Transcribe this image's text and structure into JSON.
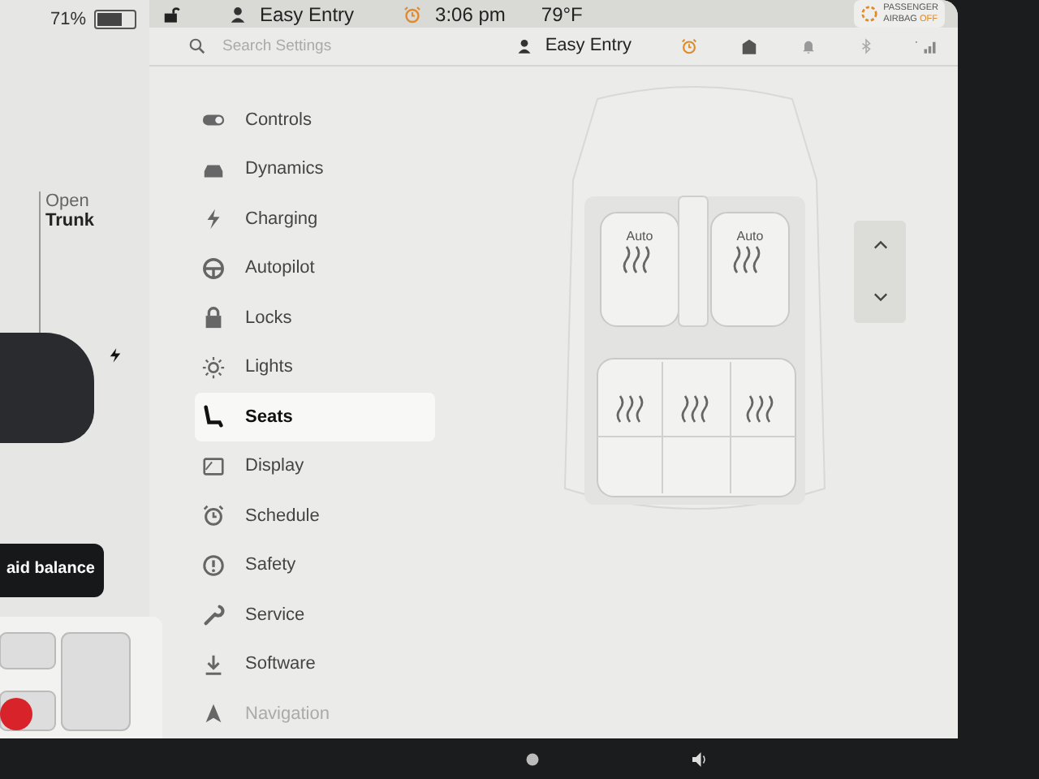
{
  "left_panel": {
    "battery_percent": "71%",
    "trunk": {
      "line1": "Open",
      "line2": "Trunk"
    },
    "banner": "aid balance"
  },
  "status_bar": {
    "profile": "Easy Entry",
    "time": "3:06 pm",
    "temperature": "79°F",
    "airbag": {
      "line1": "PASSENGER",
      "line2": "AIRBAG",
      "state": "OFF"
    }
  },
  "settings": {
    "search": {
      "placeholder": "Search Settings"
    },
    "profile": "Easy Entry",
    "menu": [
      {
        "label": "Controls",
        "kind": "toggle",
        "selected": false
      },
      {
        "label": "Dynamics",
        "kind": "car",
        "selected": false
      },
      {
        "label": "Charging",
        "kind": "bolt",
        "selected": false
      },
      {
        "label": "Autopilot",
        "kind": "wheel",
        "selected": false
      },
      {
        "label": "Locks",
        "kind": "lock",
        "selected": false
      },
      {
        "label": "Lights",
        "kind": "sun",
        "selected": false
      },
      {
        "label": "Seats",
        "kind": "seat",
        "selected": true
      },
      {
        "label": "Display",
        "kind": "display",
        "selected": false
      },
      {
        "label": "Schedule",
        "kind": "alarm",
        "selected": false
      },
      {
        "label": "Safety",
        "kind": "alert",
        "selected": false
      },
      {
        "label": "Service",
        "kind": "wrench",
        "selected": false
      },
      {
        "label": "Software",
        "kind": "download",
        "selected": false
      },
      {
        "label": "Navigation",
        "kind": "nav",
        "selected": false
      }
    ]
  },
  "seat_view": {
    "front_seat_labels": [
      "Auto",
      "Auto"
    ]
  }
}
